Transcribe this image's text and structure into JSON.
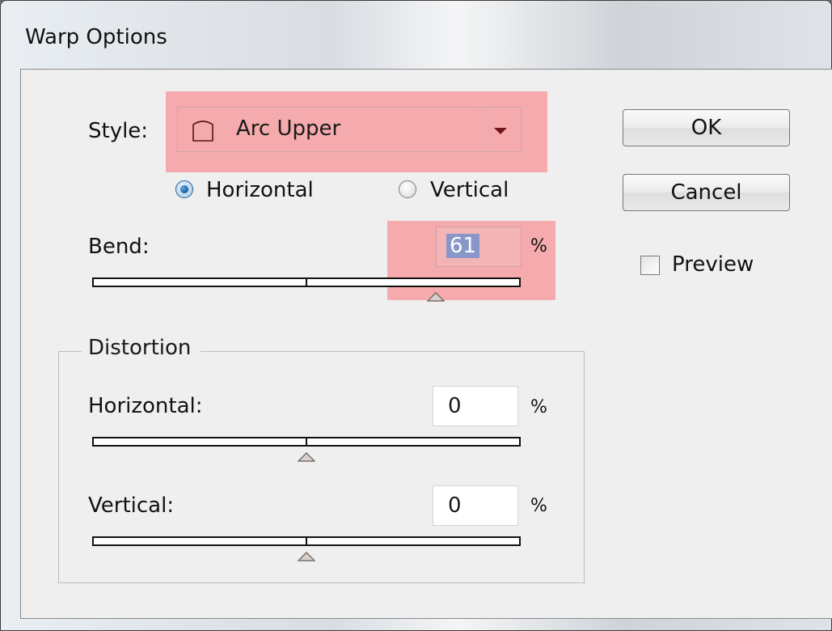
{
  "window": {
    "title": "Warp Options"
  },
  "style": {
    "label": "Style:",
    "value": "Arc Upper",
    "icon": "arc-upper-icon"
  },
  "orientation": {
    "horizontal_label": "Horizontal",
    "vertical_label": "Vertical",
    "selected": "Horizontal"
  },
  "bend": {
    "label": "Bend:",
    "value": "61",
    "unit": "%",
    "level_percent": 61
  },
  "distortion": {
    "title": "Distortion",
    "horizontal": {
      "label": "Horizontal:",
      "value": "0",
      "unit": "%",
      "level_percent": 0
    },
    "vertical": {
      "label": "Vertical:",
      "value": "0",
      "unit": "%",
      "level_percent": 0
    }
  },
  "buttons": {
    "ok": "OK",
    "cancel": "Cancel"
  },
  "preview": {
    "label": "Preview",
    "checked": false
  },
  "colors": {
    "highlight": "#f88084",
    "selection": "#8896c9",
    "radio_selected": "#1c5b9c"
  }
}
